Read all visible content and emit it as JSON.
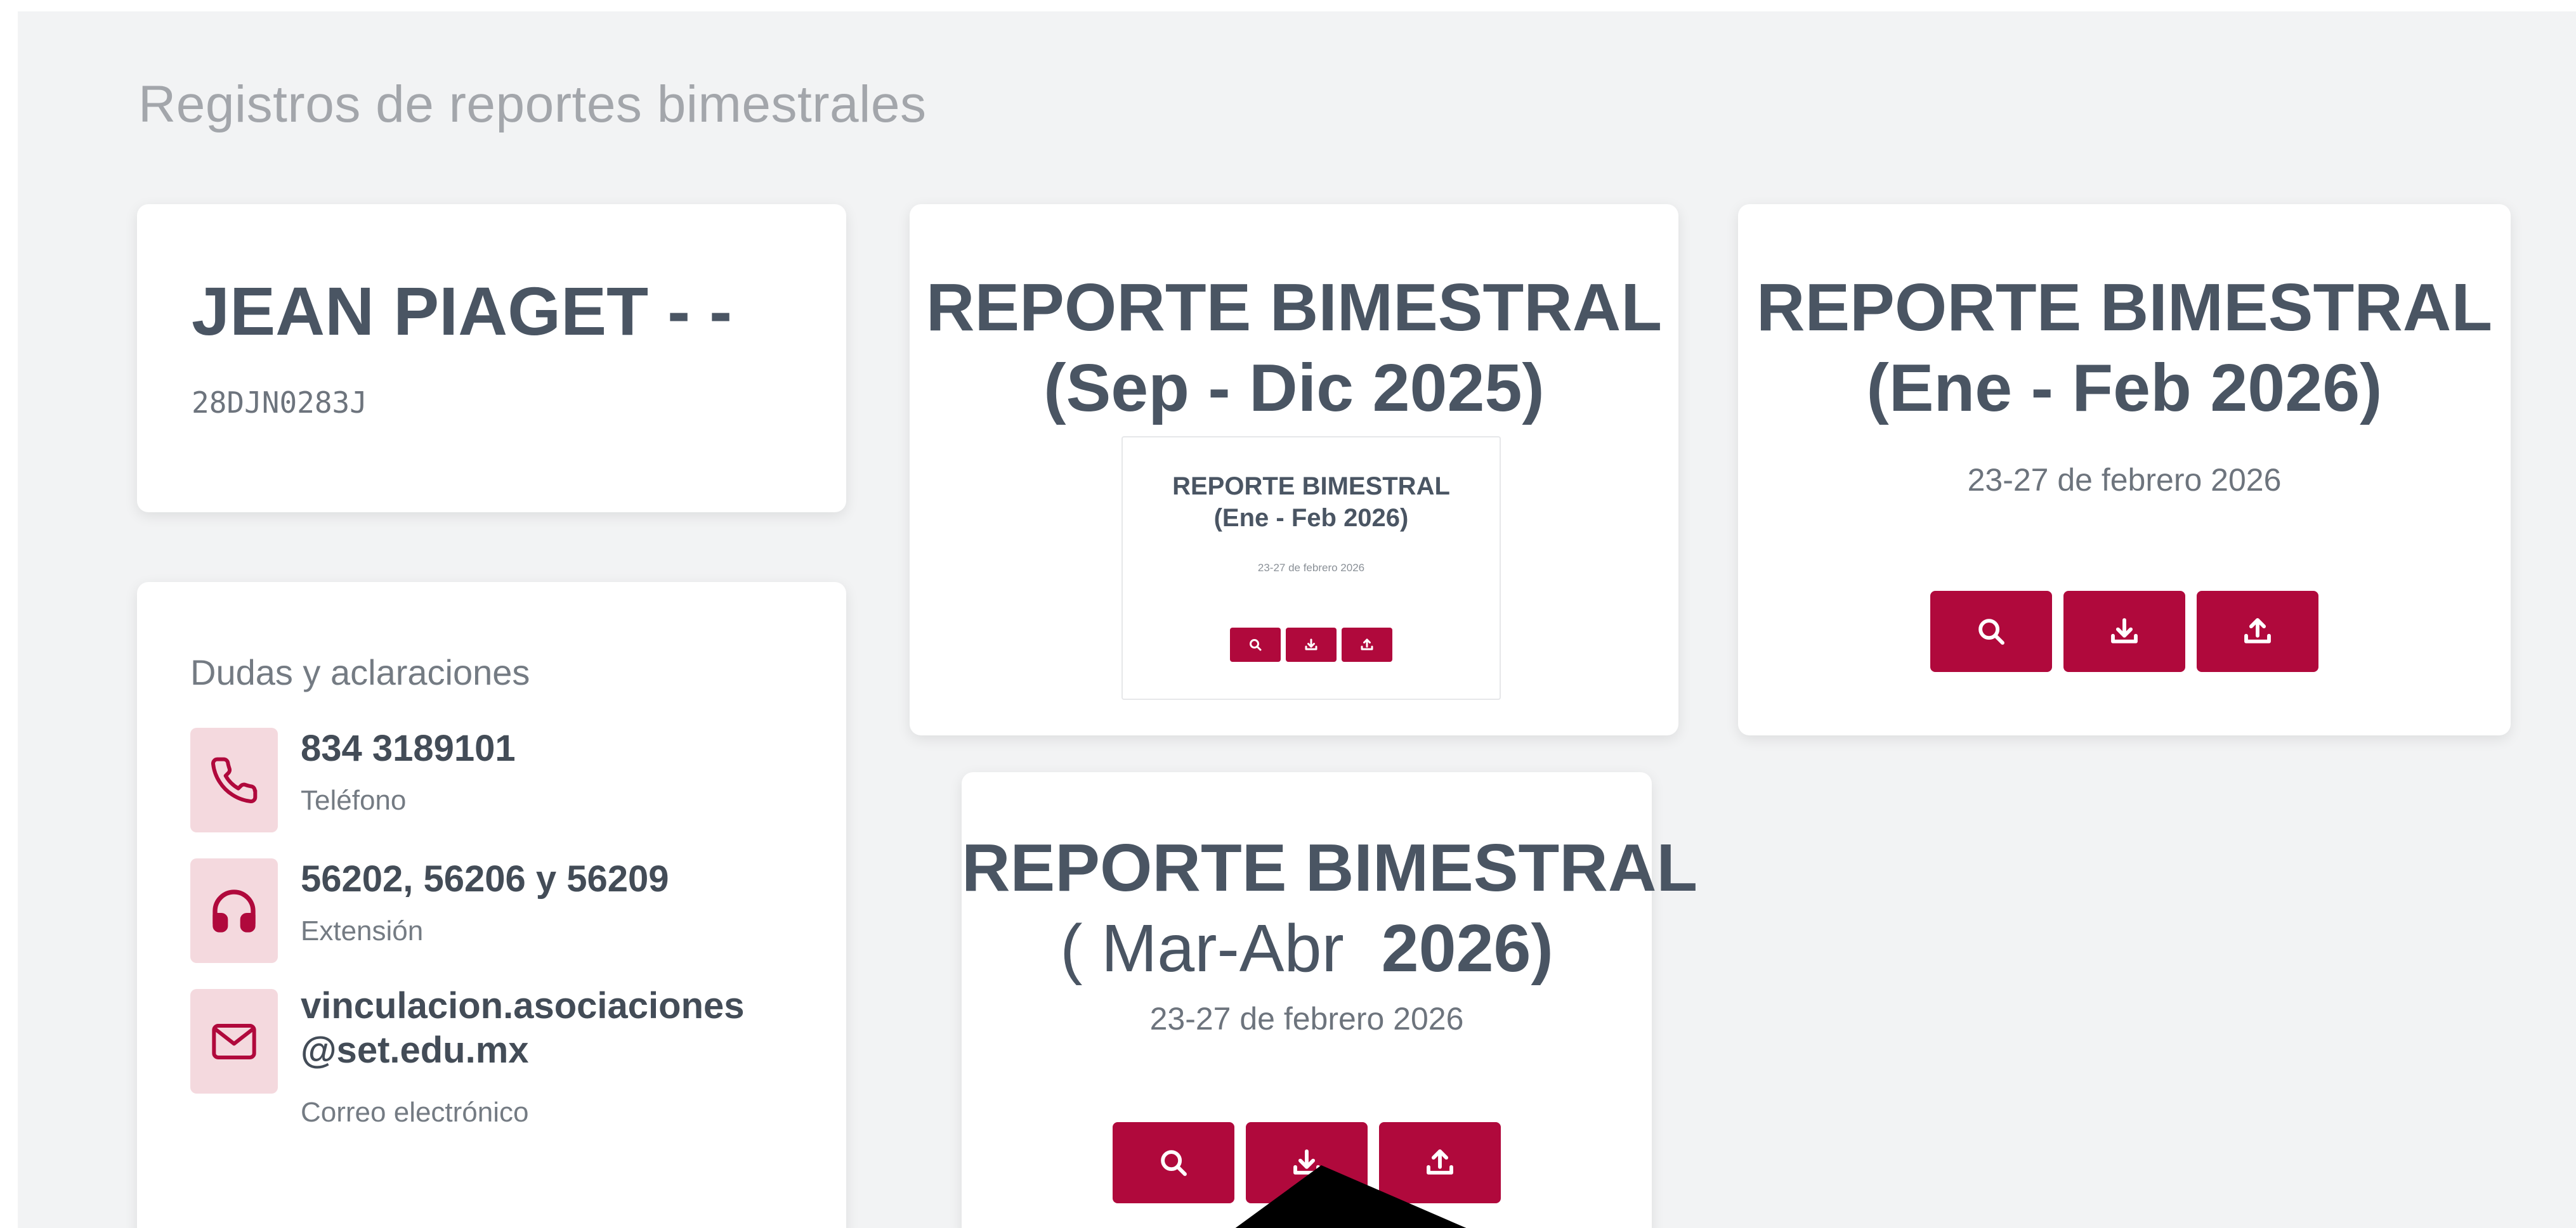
{
  "page": {
    "title": "Registros de reportes bimestrales"
  },
  "school": {
    "name": "JEAN PIAGET - -",
    "code": "28DJN0283J"
  },
  "contact": {
    "heading": "Dudas y aclaraciones",
    "items": [
      {
        "icon": "phone-icon",
        "value": "834 3189101",
        "label": "Teléfono"
      },
      {
        "icon": "headset-icon",
        "value": "56202, 56206 y 56209",
        "label": "Extensión"
      },
      {
        "icon": "mail-icon",
        "value_line1": "vinculacion.asociaciones",
        "value_line2": "@set.edu.mx",
        "label": "Correo electrónico"
      }
    ]
  },
  "reports": [
    {
      "title_line1": "REPORTE BIMESTRAL",
      "title_line2": "(Sep - Dic 2025)",
      "thumbnail": {
        "title_line1": "REPORTE BIMESTRAL",
        "title_line2": "(Ene - Feb 2026)",
        "dates": "23-27 de febrero 2026"
      }
    },
    {
      "title_line1": "REPORTE BIMESTRAL",
      "title_line2": "(Ene - Feb 2026)",
      "dates": "23-27 de febrero 2026"
    },
    {
      "title_line1": "REPORTE BIMESTRAL",
      "title_line2_part1": "( Mar-Abr",
      "title_line2_part2": "2026)",
      "dates": "23-27 de febrero 2026"
    }
  ],
  "buttons": {
    "view_icon": "search-icon",
    "download_icon": "download-icon",
    "upload_icon": "upload-icon"
  },
  "colors": {
    "accent": "#b0093c",
    "icon_bg": "#f4d9de",
    "background": "#f2f3f4",
    "title_text": "#4a5563"
  }
}
